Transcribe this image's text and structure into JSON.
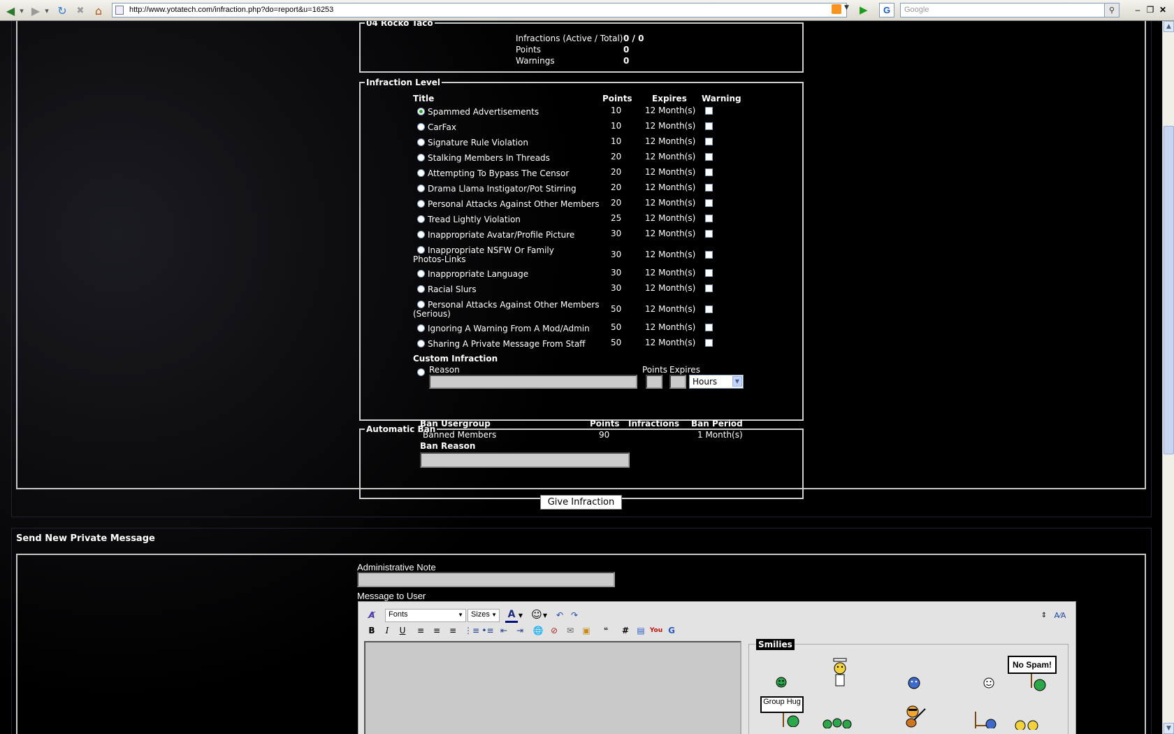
{
  "browser": {
    "url": "http://www.yotatech.com/infraction.php?do=report&u=16253",
    "search_placeholder": "Google"
  },
  "user_box": {
    "legend": "04 Rocko Taco",
    "rows": [
      {
        "label": "Infractions (Active / Total)",
        "value": "0 / 0"
      },
      {
        "label": "Points",
        "value": "0"
      },
      {
        "label": "Warnings",
        "value": "0"
      }
    ]
  },
  "infraction_level": {
    "legend": "Infraction Level",
    "headers": {
      "title": "Title",
      "points": "Points",
      "expires": "Expires",
      "warning": "Warning"
    },
    "rows": [
      {
        "title": "Spammed Advertisements",
        "title2": "",
        "points": "10",
        "expires": "12 Month(s)",
        "selected": true
      },
      {
        "title": "CarFax",
        "title2": "",
        "points": "10",
        "expires": "12 Month(s)",
        "selected": false
      },
      {
        "title": "Signature Rule Violation",
        "title2": "",
        "points": "10",
        "expires": "12 Month(s)",
        "selected": false
      },
      {
        "title": "Stalking Members In Threads",
        "title2": "",
        "points": "20",
        "expires": "12 Month(s)",
        "selected": false
      },
      {
        "title": "Attempting To Bypass The Censor",
        "title2": "",
        "points": "20",
        "expires": "12 Month(s)",
        "selected": false
      },
      {
        "title": "Drama Llama Instigator/Pot Stirring",
        "title2": "",
        "points": "20",
        "expires": "12 Month(s)",
        "selected": false
      },
      {
        "title": "Personal Attacks Against Other Members",
        "title2": "",
        "points": "20",
        "expires": "12 Month(s)",
        "selected": false
      },
      {
        "title": "Tread Lightly Violation",
        "title2": "",
        "points": "25",
        "expires": "12 Month(s)",
        "selected": false
      },
      {
        "title": "Inappropriate Avatar/Profile Picture",
        "title2": "",
        "points": "30",
        "expires": "12 Month(s)",
        "selected": false
      },
      {
        "title": "Inappropriate NSFW Or Family",
        "title2": "Photos-Links",
        "points": "30",
        "expires": "12 Month(s)",
        "selected": false
      },
      {
        "title": "Inappropriate Language",
        "title2": "",
        "points": "30",
        "expires": "12 Month(s)",
        "selected": false
      },
      {
        "title": "Racial Slurs",
        "title2": "",
        "points": "30",
        "expires": "12 Month(s)",
        "selected": false
      },
      {
        "title": "Personal Attacks Against Other Members",
        "title2": "(Serious)",
        "points": "50",
        "expires": "12 Month(s)",
        "selected": false
      },
      {
        "title": "Ignoring A Warning From A Mod/Admin",
        "title2": "",
        "points": "50",
        "expires": "12 Month(s)",
        "selected": false
      },
      {
        "title": "Sharing A Private Message From Staff",
        "title2": "",
        "points": "50",
        "expires": "12 Month(s)",
        "selected": false
      }
    ],
    "custom": {
      "heading": "Custom Infraction",
      "reason_label": "Reason",
      "points_label": "Points",
      "expires_label": "Expires",
      "unit": "Hours"
    }
  },
  "auto_ban": {
    "legend": "Automatic Ban",
    "headers": {
      "group": "Ban Usergroup",
      "points": "Points",
      "infractions": "Infractions",
      "period": "Ban Period"
    },
    "row": {
      "group": "Banned Members",
      "points": "90",
      "infractions": "",
      "period": "1 Month(s)"
    },
    "reason_label": "Ban Reason"
  },
  "give_button": "Give Infraction",
  "pm": {
    "heading": "Send New Private Message",
    "admin_note_label": "Administrative Note",
    "message_label": "Message to User",
    "fonts": "Fonts",
    "sizes": "Sizes",
    "smilies_legend": "Smilies",
    "smiley_sign1": "No Spam!",
    "smiley_sign2": "Group Hug"
  }
}
